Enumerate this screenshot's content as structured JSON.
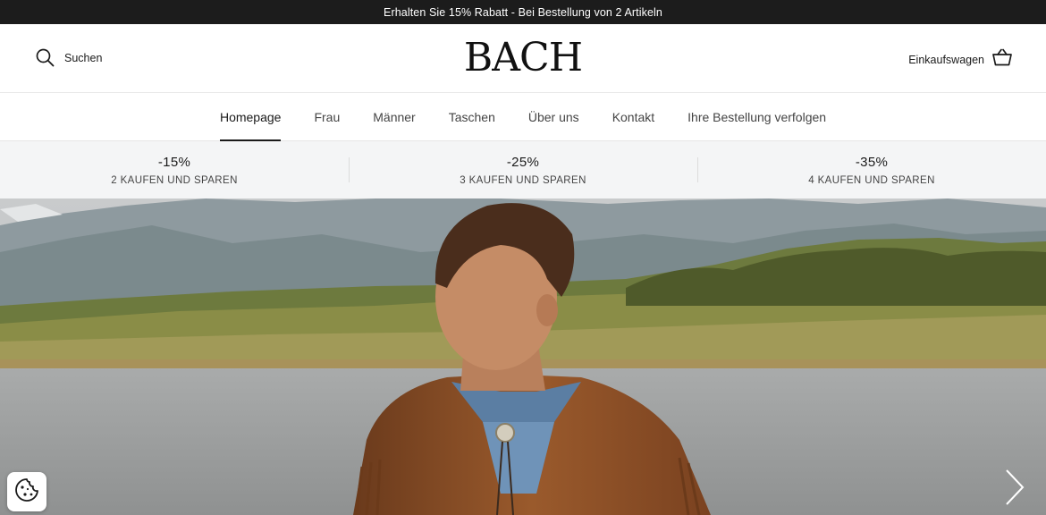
{
  "announcement": "Erhalten Sie 15% Rabatt - Bei Bestellung von 2 Artikeln",
  "header": {
    "search_label": "Suchen",
    "logo": "BACH",
    "cart_label": "Einkaufswagen",
    "search_icon": "search-icon",
    "cart_icon": "basket-icon"
  },
  "nav": {
    "items": [
      {
        "label": "Homepage",
        "active": true
      },
      {
        "label": "Frau"
      },
      {
        "label": "Männer"
      },
      {
        "label": "Taschen"
      },
      {
        "label": "Über uns"
      },
      {
        "label": "Kontakt"
      },
      {
        "label": "Ihre Bestellung verfolgen"
      }
    ]
  },
  "promos": [
    {
      "discount": "-15%",
      "text": "2 KAUFEN UND SPAREN"
    },
    {
      "discount": "-25%",
      "text": "3 KAUFEN UND SPAREN"
    },
    {
      "discount": "-35%",
      "text": "4 KAUFEN UND SPAREN"
    }
  ],
  "hero": {
    "image": "man-in-suede-fringe-jacket-by-lake",
    "next_icon": "chevron-right-icon"
  },
  "cookie_icon": "cookie-icon",
  "colors": {
    "announcement_bg": "#1c1c1c",
    "promo_bg": "#f4f5f6",
    "text": "#1a1a1a"
  }
}
